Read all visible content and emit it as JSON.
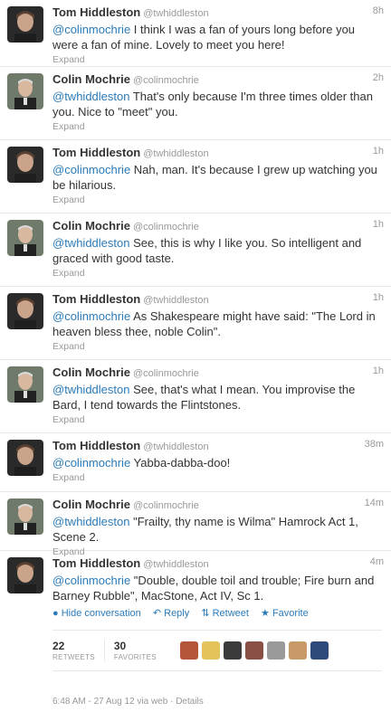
{
  "tweets": [
    {
      "name": "Tom Hiddleston",
      "handle": "@twhiddleston",
      "time": "8h",
      "mention": "@colinmochrie",
      "text": " I think I was a fan of yours long before you were a fan of mine. Lovely to meet you here!",
      "expand": "Expand"
    },
    {
      "name": "Colin Mochrie",
      "handle": "@colinmochrie",
      "time": "2h",
      "mention": "@twhiddleston",
      "text": " That's only because I'm three times older than you. Nice to \"meet\" you.",
      "expand": "Expand"
    },
    {
      "name": "Tom Hiddleston",
      "handle": "@twhiddleston",
      "time": "1h",
      "mention": "@colinmochrie",
      "text": " Nah, man. It's because I grew up watching you be hilarious.",
      "expand": "Expand"
    },
    {
      "name": "Colin Mochrie",
      "handle": "@colinmochrie",
      "time": "1h",
      "mention": "@twhiddleston",
      "text": " See, this is why I like you. So intelligent and graced with good taste.",
      "expand": "Expand"
    },
    {
      "name": "Tom Hiddleston",
      "handle": "@twhiddleston",
      "time": "1h",
      "mention": "@colinmochrie",
      "text": " As Shakespeare might have said: \"The Lord in heaven bless thee, noble Colin\".",
      "expand": "Expand"
    },
    {
      "name": "Colin Mochrie",
      "handle": "@colinmochrie",
      "time": "1h",
      "mention": "@twhiddleston",
      "text": " See, that's what I mean. You improvise the Bard, I tend towards the Flintstones.",
      "expand": "Expand"
    },
    {
      "name": "Tom Hiddleston",
      "handle": "@twhiddleston",
      "time": "38m",
      "mention": "@colinmochrie",
      "text": " Yabba-dabba-doo!",
      "expand": "Expand"
    },
    {
      "name": "Colin Mochrie",
      "handle": "@colinmochrie",
      "time": "14m",
      "mention": "@twhiddleston",
      "text": " \"Frailty, thy name is Wilma\" Hamrock Act 1, Scene 2.",
      "expand": "Expand"
    },
    {
      "name": "Tom Hiddleston",
      "handle": "@twhiddleston",
      "time": "4m",
      "mention": "@colinmochrie",
      "text": " \"Double, double toil and trouble; Fire burn and Barney Rubble\", MacStone, Act IV, Sc 1."
    }
  ],
  "actions": {
    "hide": "Hide conversation",
    "reply": "Reply",
    "retweet": "Retweet",
    "favorite": "Favorite"
  },
  "stats": {
    "retweets_count": "22",
    "retweets_label": "RETWEETS",
    "favorites_count": "30",
    "favorites_label": "FAVORITES"
  },
  "footer": "6:48 AM - 27 Aug 12 via web · Details",
  "colors": {
    "link": "#2b7bb9",
    "muted": "#999999",
    "divider": "#e8e8e8"
  }
}
